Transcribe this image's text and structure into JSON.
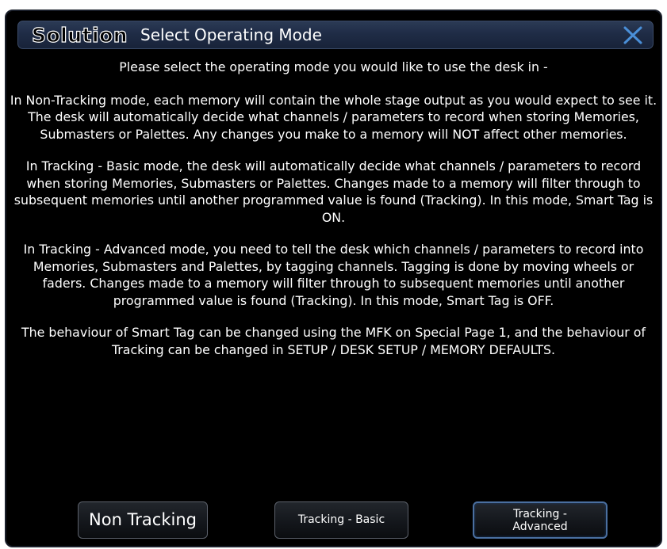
{
  "dialog": {
    "brand": "Solution",
    "title": "Select Operating Mode",
    "close_icon": "close-x-icon",
    "accent_color": "#4a8fd8",
    "paragraphs": [
      "Please select the operating mode you would like to use the desk in -",
      "In Non-Tracking mode, each memory will contain the whole stage output as you would expect to see it.  The desk will automatically decide what channels / parameters to record when storing Memories, Submasters or Palettes.  Any changes you make to a memory will NOT affect other memories.",
      "In Tracking - Basic mode, the desk will automatically decide what channels / parameters to record when storing Memories, Submasters or Palettes. Changes made to a memory will filter through to subsequent memories until another programmed value is found (Tracking).  In this mode, Smart Tag is ON.",
      "In Tracking - Advanced mode, you need to tell the desk which channels / parameters to record into Memories, Submasters and Palettes, by tagging channels.  Tagging is done by moving wheels or faders.  Changes made to a memory will filter through to subsequent memories until another programmed value is found (Tracking).  In this mode, Smart Tag is OFF.",
      "The behaviour of Smart Tag can be changed using the MFK on Special Page 1, and the behaviour of Tracking can be changed in SETUP / DESK SETUP / MEMORY DEFAULTS."
    ],
    "buttons": {
      "non_tracking": "Non Tracking",
      "tracking_basic": "Tracking - Basic",
      "tracking_advanced_line1": "Tracking -",
      "tracking_advanced_line2": "Advanced"
    }
  }
}
